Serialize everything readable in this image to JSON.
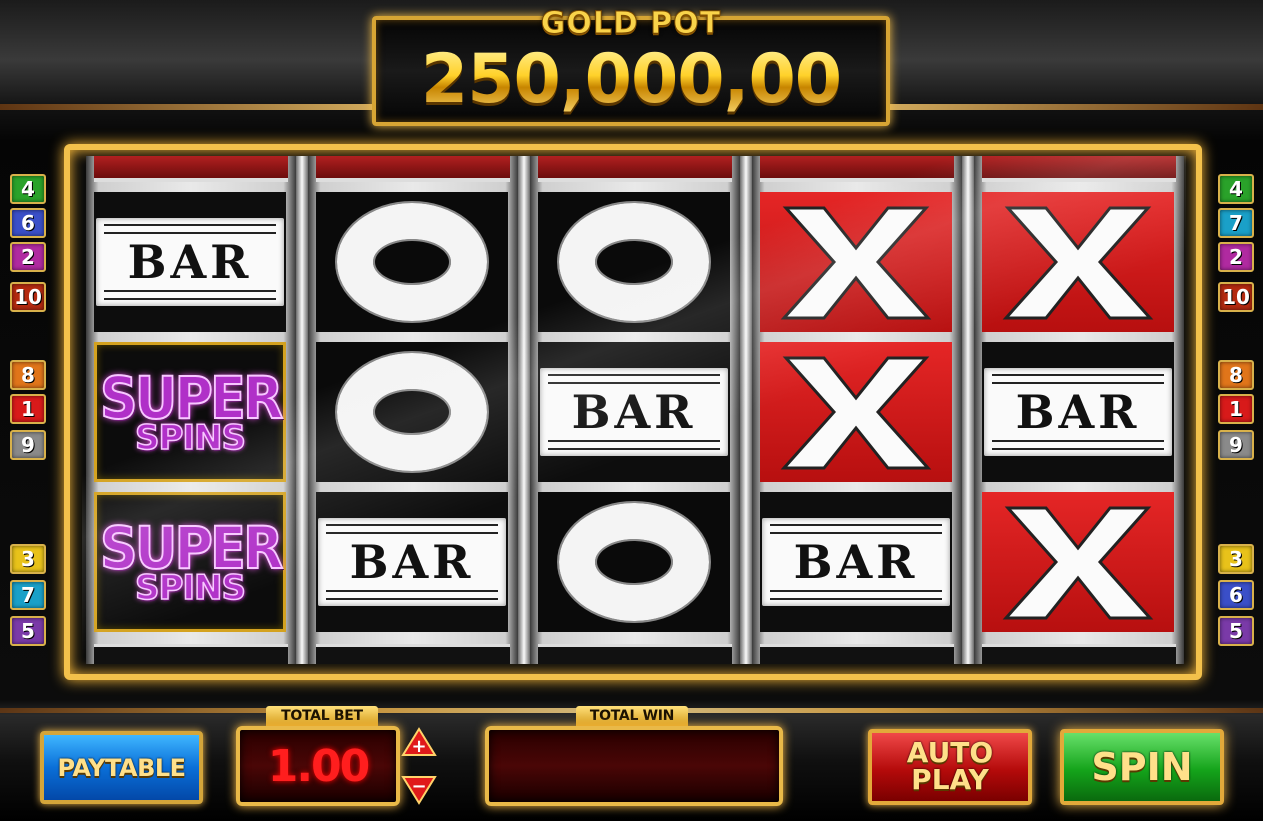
{
  "jackpot": {
    "title": "GOLD POT",
    "value": "250,000,00"
  },
  "reels": [
    {
      "symbols": [
        "BAR",
        "SUPER SPINS",
        "SUPER SPINS"
      ]
    },
    {
      "symbols": [
        "O",
        "O",
        "BAR"
      ]
    },
    {
      "symbols": [
        "O",
        "BAR",
        "O"
      ]
    },
    {
      "symbols": [
        "X",
        "X",
        "BAR"
      ]
    },
    {
      "symbols": [
        "X",
        "BAR",
        "X"
      ]
    }
  ],
  "symbol_text": {
    "bar": "BAR",
    "super_line1": "SUPER",
    "super_line2": "SPINS"
  },
  "paylines": {
    "left": [
      {
        "num": "4",
        "color": "#2aa22a"
      },
      {
        "num": "6",
        "color": "#3a4fc8"
      },
      {
        "num": "2",
        "color": "#b02aa0"
      },
      {
        "num": "10",
        "color": "#b42a10"
      },
      {
        "num": "8",
        "color": "#e0751a"
      },
      {
        "num": "1",
        "color": "#d81a1a"
      },
      {
        "num": "9",
        "color": "#8a8a8a"
      },
      {
        "num": "3",
        "color": "#e8c21a"
      },
      {
        "num": "7",
        "color": "#1aa0c8"
      },
      {
        "num": "5",
        "color": "#7a3aa8"
      }
    ],
    "right": [
      {
        "num": "4",
        "color": "#2aa22a"
      },
      {
        "num": "7",
        "color": "#1aa0c8"
      },
      {
        "num": "2",
        "color": "#b02aa0"
      },
      {
        "num": "10",
        "color": "#b42a10"
      },
      {
        "num": "8",
        "color": "#e0751a"
      },
      {
        "num": "1",
        "color": "#d81a1a"
      },
      {
        "num": "9",
        "color": "#8a8a8a"
      },
      {
        "num": "3",
        "color": "#e8c21a"
      },
      {
        "num": "6",
        "color": "#3a4fc8"
      },
      {
        "num": "5",
        "color": "#7a3aa8"
      }
    ]
  },
  "controls": {
    "paytable_label": "PAYTABLE",
    "total_bet_label": "TOTAL BET",
    "total_bet_value": "1.00",
    "total_win_label": "TOTAL WIN",
    "total_win_value": "",
    "auto_line1": "AUTO",
    "auto_line2": "PLAY",
    "spin_label": "SPIN",
    "increase_icon": "plus-arrow-icon",
    "decrease_icon": "minus-arrow-icon"
  }
}
